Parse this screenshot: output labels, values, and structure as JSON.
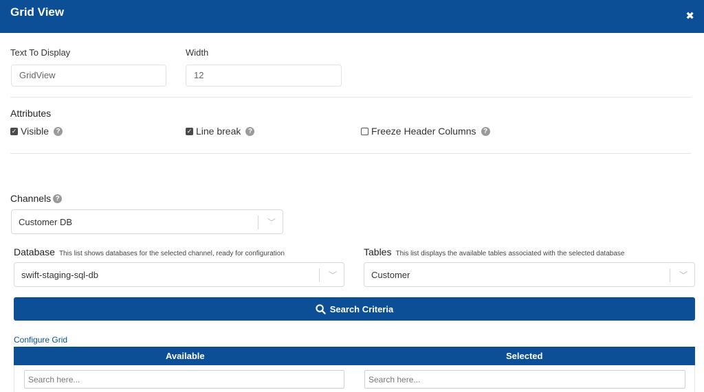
{
  "header": {
    "title": "Grid View",
    "close_icon": "close-icon"
  },
  "text_to_display": {
    "label": "Text To Display",
    "value": "GridView"
  },
  "width": {
    "label": "Width",
    "value": "12"
  },
  "attributes": {
    "title": "Attributes",
    "visible": {
      "label": "Visible",
      "checked": true
    },
    "line_break": {
      "label": "Line break",
      "checked": true
    },
    "freeze_header": {
      "label": "Freeze Header Columns",
      "checked": false
    }
  },
  "channels": {
    "label": "Channels",
    "value": "Customer DB"
  },
  "database": {
    "label": "Database",
    "hint": "This list shows databases for the selected channel, ready for configuration",
    "value": "swift-staging-sql-db"
  },
  "tables": {
    "label": "Tables",
    "hint": "This list displays the available tables associated with the selected database",
    "value": "Customer"
  },
  "search_button": {
    "label": "Search Criteria"
  },
  "configure_grid": {
    "label": "Configure Grid"
  },
  "grid": {
    "available": "Available",
    "selected": "Selected",
    "available_placeholder": "Search here...",
    "selected_placeholder": "Search here..."
  },
  "colors": {
    "primary": "#0d4f96"
  }
}
